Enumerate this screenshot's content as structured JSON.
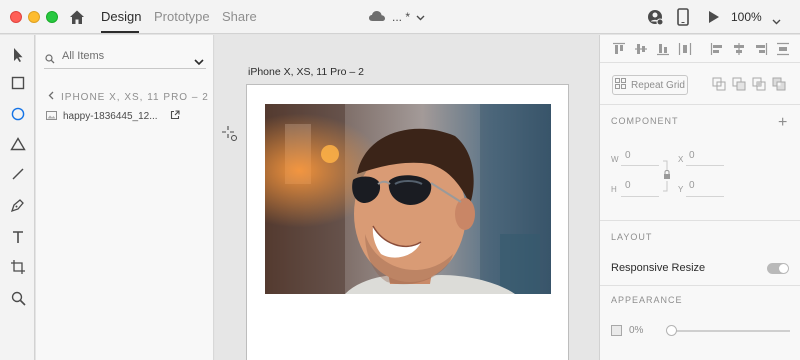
{
  "titlebar": {
    "tabs": [
      {
        "label": "Design",
        "active": true
      },
      {
        "label": "Prototype",
        "active": false
      },
      {
        "label": "Share",
        "active": false
      }
    ],
    "doc_title": "... *",
    "zoom": "100%",
    "icons": [
      "home-icon",
      "cloud-icon",
      "user-icon",
      "mobile-preview-icon",
      "play-icon",
      "chevron-down-icon"
    ]
  },
  "toolbar": {
    "tools": [
      "select-tool",
      "rectangle-tool",
      "ellipse-tool",
      "polygon-tool",
      "line-tool",
      "pen-tool",
      "text-tool",
      "artboard-tool",
      "zoom-tool"
    ],
    "active_tool": "ellipse-tool"
  },
  "layers": {
    "search_placeholder": "All Items",
    "artboard_name": "IPHONE X, XS, 11 PRO – 2",
    "item_name": "happy-1836445_12..."
  },
  "canvas": {
    "artboard_label": "iPhone X, XS, 11 Pro – 2",
    "image_subject": "smiling man wearing sunglasses"
  },
  "props": {
    "repeat_grid_label": "Repeat Grid",
    "component_title": "COMPONENT",
    "w_label": "W",
    "w_value": "0",
    "h_label": "H",
    "h_value": "0",
    "x_label": "X",
    "x_value": "0",
    "y_label": "Y",
    "y_value": "0",
    "layout_title": "LAYOUT",
    "responsive_resize_label": "Responsive Resize",
    "responsive_resize_on": false,
    "appearance_title": "APPEARANCE",
    "opacity_value": "0%"
  },
  "colors": {
    "accent_active": "#2c2c2c",
    "ellipse_tool": "#1473e6",
    "close": "#ff5f57",
    "minimize": "#febc2e",
    "maximize": "#28c840"
  }
}
